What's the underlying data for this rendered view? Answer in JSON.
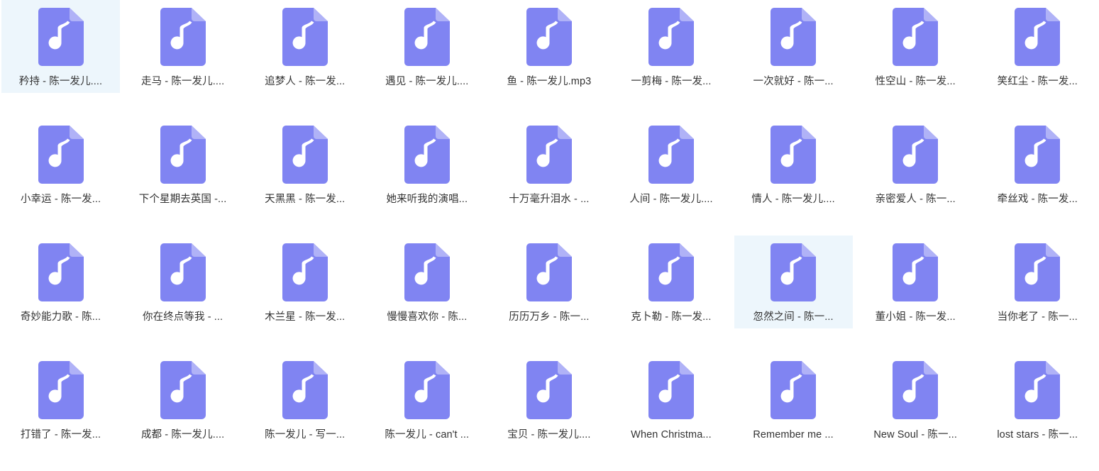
{
  "view": {
    "name": "file-explorer-icon-grid",
    "columns": 9,
    "rows": 4,
    "icon_name": "audio-file-icon",
    "colors": {
      "icon_body": "#8084f2",
      "icon_fold": "#b0b2f7",
      "note_glyph": "#ffffff",
      "selection_background": "#edf6fc",
      "label_text": "#333333",
      "page_background": "#ffffff"
    }
  },
  "files": [
    {
      "label": "矜持 - 陈一发儿....",
      "selected": true
    },
    {
      "label": "走马 - 陈一发儿....",
      "selected": false
    },
    {
      "label": "追梦人 - 陈一发...",
      "selected": false
    },
    {
      "label": "遇见 - 陈一发儿....",
      "selected": false
    },
    {
      "label": "鱼 - 陈一发儿.mp3",
      "selected": false
    },
    {
      "label": "一剪梅 - 陈一发...",
      "selected": false
    },
    {
      "label": "一次就好 - 陈一...",
      "selected": false
    },
    {
      "label": "性空山 - 陈一发...",
      "selected": false
    },
    {
      "label": "笑红尘 - 陈一发...",
      "selected": false
    },
    {
      "label": "小幸运 - 陈一发...",
      "selected": false
    },
    {
      "label": "下个星期去英国 -...",
      "selected": false
    },
    {
      "label": "天黑黑 - 陈一发...",
      "selected": false
    },
    {
      "label": "她来听我的演唱...",
      "selected": false
    },
    {
      "label": "十万毫升泪水 - ...",
      "selected": false
    },
    {
      "label": "人间 - 陈一发儿....",
      "selected": false
    },
    {
      "label": "情人 - 陈一发儿....",
      "selected": false
    },
    {
      "label": "亲密爱人 - 陈一...",
      "selected": false
    },
    {
      "label": "牵丝戏 - 陈一发...",
      "selected": false
    },
    {
      "label": "奇妙能力歌 - 陈...",
      "selected": false
    },
    {
      "label": "你在终点等我 - ...",
      "selected": false
    },
    {
      "label": "木兰星 - 陈一发...",
      "selected": false
    },
    {
      "label": "慢慢喜欢你 - 陈...",
      "selected": false
    },
    {
      "label": "历历万乡 - 陈一...",
      "selected": false
    },
    {
      "label": "克卜勒 - 陈一发...",
      "selected": false
    },
    {
      "label": "忽然之间 - 陈一...",
      "selected": true
    },
    {
      "label": "董小姐 - 陈一发...",
      "selected": false
    },
    {
      "label": "当你老了 - 陈一...",
      "selected": false
    },
    {
      "label": "打错了 - 陈一发...",
      "selected": false
    },
    {
      "label": "成都 - 陈一发儿....",
      "selected": false
    },
    {
      "label": "陈一发儿 - 写一...",
      "selected": false
    },
    {
      "label": "陈一发儿 - can't ...",
      "selected": false
    },
    {
      "label": "宝贝 - 陈一发儿....",
      "selected": false
    },
    {
      "label": "When Christma...",
      "selected": false
    },
    {
      "label": "Remember me ...",
      "selected": false
    },
    {
      "label": "New Soul - 陈一...",
      "selected": false
    },
    {
      "label": "lost stars - 陈一...",
      "selected": false
    }
  ]
}
